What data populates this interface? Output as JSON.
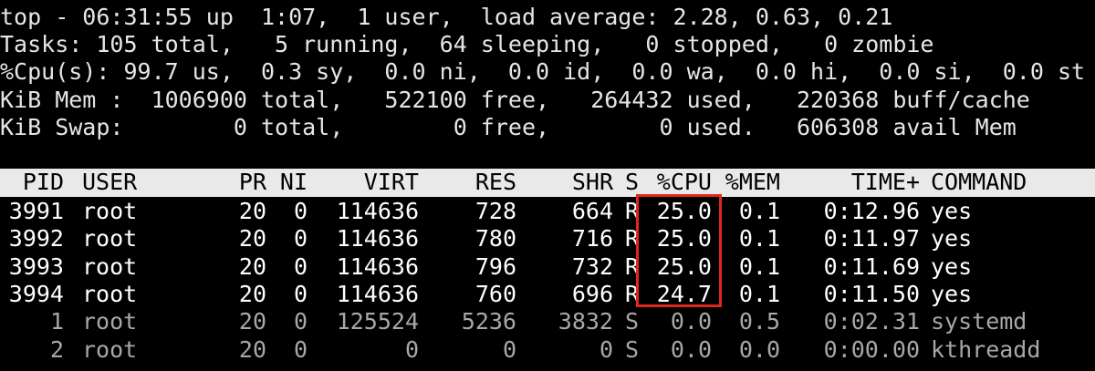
{
  "summary": {
    "line1": "top - 06:31:55 up  1:07,  1 user,  load average: 2.28, 0.63, 0.21",
    "line2": "Tasks: 105 total,   5 running,  64 sleeping,   0 stopped,   0 zombie",
    "line3": "%Cpu(s): 99.7 us,  0.3 sy,  0.0 ni,  0.0 id,  0.0 wa,  0.0 hi,  0.0 si,  0.0 st",
    "line4": "KiB Mem :  1006900 total,   522100 free,   264432 used,   220368 buff/cache",
    "line5": "KiB Swap:        0 total,        0 free,        0 used.   606308 avail Mem"
  },
  "columns": {
    "pid": "PID",
    "user": "USER",
    "pr": "PR",
    "ni": "NI",
    "virt": "VIRT",
    "res": "RES",
    "shr": "SHR",
    "s": "S",
    "cpu": "%CPU",
    "mem": "%MEM",
    "time": "TIME+",
    "command": "COMMAND"
  },
  "processes": [
    {
      "pid": "3991",
      "user": "root",
      "pr": "20",
      "ni": "0",
      "virt": "114636",
      "res": "728",
      "shr": "664",
      "s": "R",
      "cpu": "25.0",
      "mem": "0.1",
      "time": "0:12.96",
      "command": "yes"
    },
    {
      "pid": "3992",
      "user": "root",
      "pr": "20",
      "ni": "0",
      "virt": "114636",
      "res": "780",
      "shr": "716",
      "s": "R",
      "cpu": "25.0",
      "mem": "0.1",
      "time": "0:11.97",
      "command": "yes"
    },
    {
      "pid": "3993",
      "user": "root",
      "pr": "20",
      "ni": "0",
      "virt": "114636",
      "res": "796",
      "shr": "732",
      "s": "R",
      "cpu": "25.0",
      "mem": "0.1",
      "time": "0:11.69",
      "command": "yes"
    },
    {
      "pid": "3994",
      "user": "root",
      "pr": "20",
      "ni": "0",
      "virt": "114636",
      "res": "760",
      "shr": "696",
      "s": "R",
      "cpu": "24.7",
      "mem": "0.1",
      "time": "0:11.50",
      "command": "yes"
    },
    {
      "pid": "1",
      "user": "root",
      "pr": "20",
      "ni": "0",
      "virt": "125524",
      "res": "5236",
      "shr": "3832",
      "s": "S",
      "cpu": "0.0",
      "mem": "0.5",
      "time": "0:02.31",
      "command": "systemd"
    },
    {
      "pid": "2",
      "user": "root",
      "pr": "20",
      "ni": "0",
      "virt": "0",
      "res": "0",
      "shr": "0",
      "s": "S",
      "cpu": "0.0",
      "mem": "0.0",
      "time": "0:00.00",
      "command": "kthreadd"
    }
  ],
  "colors": {
    "background": "#000000",
    "text": "#e6e6e6",
    "header_bar": "#e9e9e9",
    "highlight": "#e3261b"
  }
}
